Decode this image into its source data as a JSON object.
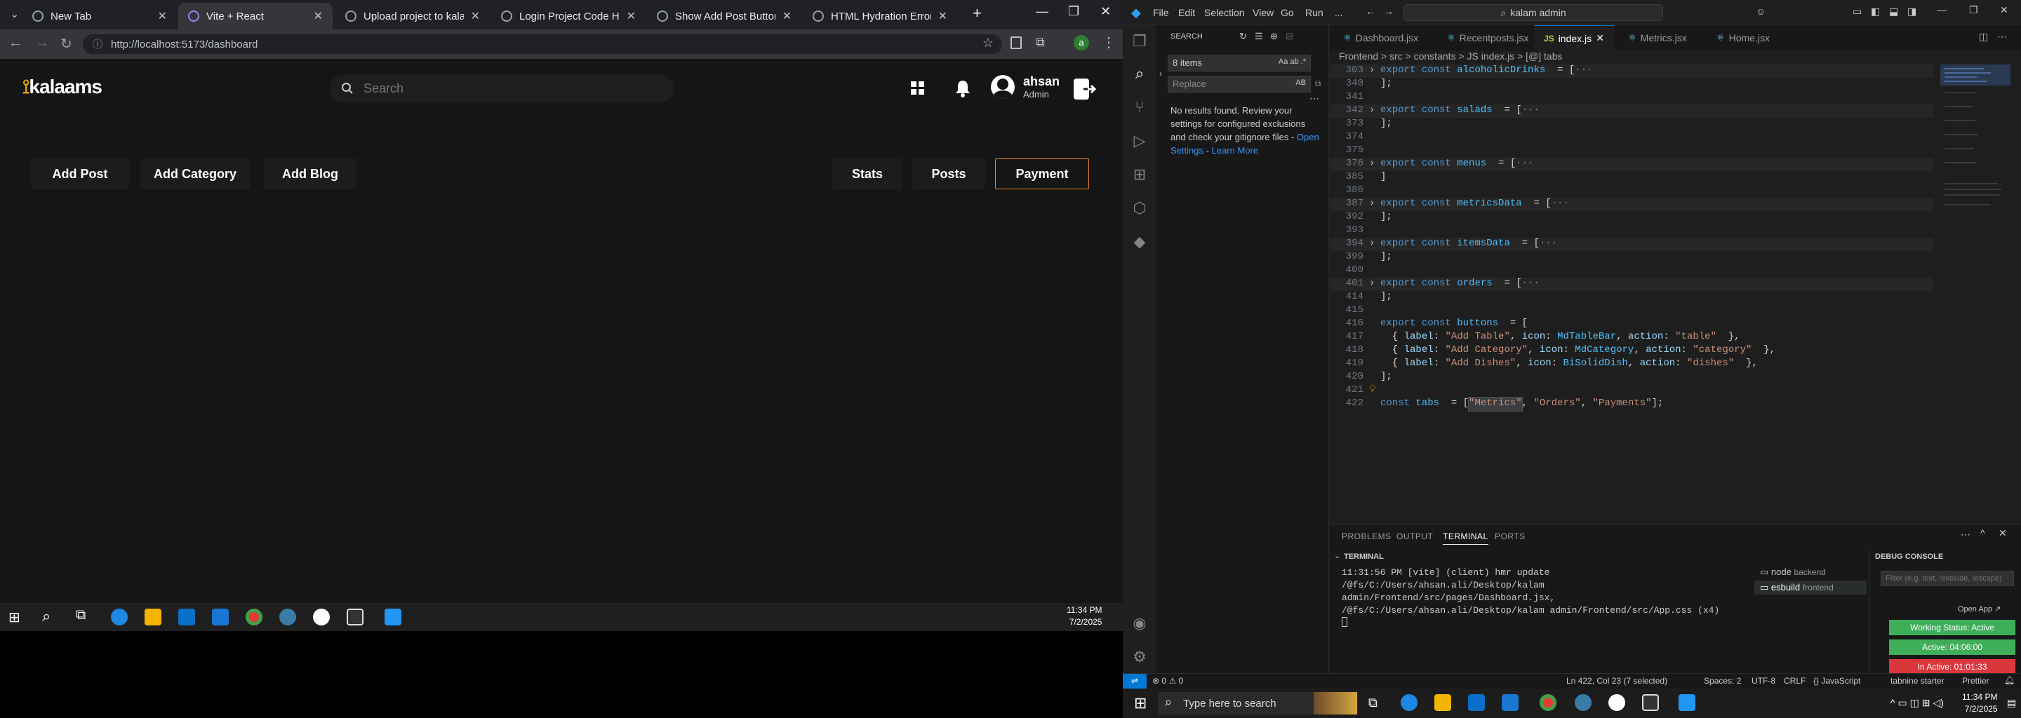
{
  "browser": {
    "tabs": [
      {
        "label": "New Tab"
      },
      {
        "label": "Vite + React"
      },
      {
        "label": "Upload project to kalams.org"
      },
      {
        "label": "Login Project Code Help"
      },
      {
        "label": "Show Add Post Button"
      },
      {
        "label": "HTML Hydration Error Fix"
      }
    ],
    "active_tab_index": 1,
    "url": "http://localhost:5173/dashboard"
  },
  "app": {
    "logo_text": "kalaams",
    "search_placeholder": "Search",
    "user_name": "ahsan",
    "user_role": "Admin",
    "left_actions": [
      "Add Post",
      "Add Category",
      "Add Blog"
    ],
    "right_tabs": [
      "Stats",
      "Posts",
      "Payment"
    ],
    "selected_right_tab": "Payment"
  },
  "taskbar_left": {
    "time": "11:34 PM",
    "date": "7/2/2025"
  },
  "vscode": {
    "menu": [
      "File",
      "Edit",
      "Selection",
      "View",
      "Go",
      "Run",
      "..."
    ],
    "command_center": "kalam admin",
    "search_panel": {
      "title": "SEARCH",
      "query": "8 items",
      "replace_placeholder": "Replace",
      "message": "No results found. Review your settings for configured exclusions and check your gitignore files -",
      "link1": "Open Settings",
      "sep": " - ",
      "link2": "Learn More"
    },
    "editor_tabs": [
      "Dashboard.jsx",
      "Recentposts.jsx",
      "index.js",
      "Metrics.jsx",
      "Home.jsx"
    ],
    "active_editor_tab": "index.js",
    "breadcrumb": "Frontend > src > constants > JS index.js > [@] tabs",
    "code_lines": [
      {
        "n": "303",
        "fold": true,
        "band": true,
        "code": [
          [
            "kw",
            "export "
          ],
          [
            "kw",
            "const "
          ],
          [
            "id",
            "alcoholicDrinks"
          ],
          [
            "",
            "  = ["
          ],
          [
            "dot",
            "···"
          ]
        ]
      },
      {
        "n": "340",
        "code": [
          [
            "",
            "];"
          ]
        ]
      },
      {
        "n": "341",
        "code": []
      },
      {
        "n": "342",
        "fold": true,
        "band": true,
        "code": [
          [
            "kw",
            "export "
          ],
          [
            "kw",
            "const "
          ],
          [
            "id",
            "salads"
          ],
          [
            "",
            "  = ["
          ],
          [
            "dot",
            "···"
          ]
        ]
      },
      {
        "n": "373",
        "code": [
          [
            "",
            "];"
          ]
        ]
      },
      {
        "n": "374",
        "code": []
      },
      {
        "n": "375",
        "code": []
      },
      {
        "n": "376",
        "fold": true,
        "band": true,
        "code": [
          [
            "kw",
            "export "
          ],
          [
            "kw",
            "const "
          ],
          [
            "id",
            "menus"
          ],
          [
            "",
            "  = ["
          ],
          [
            "dot",
            "···"
          ]
        ]
      },
      {
        "n": "385",
        "code": [
          [
            "",
            "]"
          ]
        ]
      },
      {
        "n": "386",
        "code": []
      },
      {
        "n": "387",
        "fold": true,
        "band": true,
        "code": [
          [
            "kw",
            "export "
          ],
          [
            "kw",
            "const "
          ],
          [
            "id",
            "metricsData"
          ],
          [
            "",
            "  = ["
          ],
          [
            "dot",
            "···"
          ]
        ]
      },
      {
        "n": "392",
        "code": [
          [
            "",
            "];"
          ]
        ]
      },
      {
        "n": "393",
        "code": []
      },
      {
        "n": "394",
        "fold": true,
        "band": true,
        "code": [
          [
            "kw",
            "export "
          ],
          [
            "kw",
            "const "
          ],
          [
            "id",
            "itemsData"
          ],
          [
            "",
            "  = ["
          ],
          [
            "dot",
            "···"
          ]
        ]
      },
      {
        "n": "399",
        "code": [
          [
            "",
            "];"
          ]
        ]
      },
      {
        "n": "400",
        "code": []
      },
      {
        "n": "401",
        "fold": true,
        "band": true,
        "code": [
          [
            "kw",
            "export "
          ],
          [
            "kw",
            "const "
          ],
          [
            "id",
            "orders"
          ],
          [
            "",
            "  = ["
          ],
          [
            "dot",
            "···"
          ]
        ]
      },
      {
        "n": "414",
        "code": [
          [
            "",
            "];"
          ]
        ]
      },
      {
        "n": "415",
        "code": []
      },
      {
        "n": "416",
        "code": [
          [
            "kw",
            "export "
          ],
          [
            "kw",
            "const "
          ],
          [
            "id",
            "buttons"
          ],
          [
            "",
            ""
          ],
          [
            "",
            "  = ["
          ]
        ]
      },
      {
        "n": "417",
        "code": [
          [
            "",
            "  { "
          ],
          [
            "pr",
            "label"
          ],
          [
            "",
            ": "
          ],
          [
            "st",
            "\"Add Table\""
          ],
          [
            "",
            ", "
          ],
          [
            "pr",
            "icon"
          ],
          [
            "",
            ": "
          ],
          [
            "id",
            "MdTableBar"
          ],
          [
            "",
            ", "
          ],
          [
            "pr",
            "action"
          ],
          [
            "",
            ": "
          ],
          [
            "st",
            "\"table\""
          ],
          [
            "",
            "  },"
          ]
        ]
      },
      {
        "n": "418",
        "code": [
          [
            "",
            "  { "
          ],
          [
            "pr",
            "label"
          ],
          [
            "",
            ": "
          ],
          [
            "st",
            "\"Add Category\""
          ],
          [
            "",
            ", "
          ],
          [
            "pr",
            "icon"
          ],
          [
            "",
            ": "
          ],
          [
            "id",
            "MdCategory"
          ],
          [
            "",
            ", "
          ],
          [
            "pr",
            "action"
          ],
          [
            "",
            ": "
          ],
          [
            "st",
            "\"category\""
          ],
          [
            "",
            "  },"
          ]
        ]
      },
      {
        "n": "419",
        "code": [
          [
            "",
            "  { "
          ],
          [
            "pr",
            "label"
          ],
          [
            "",
            ": "
          ],
          [
            "st",
            "\"Add Dishes\""
          ],
          [
            "",
            ", "
          ],
          [
            "pr",
            "icon"
          ],
          [
            "",
            ": "
          ],
          [
            "id",
            "BiSolidDish"
          ],
          [
            "",
            ", "
          ],
          [
            "pr",
            "action"
          ],
          [
            "",
            ": "
          ],
          [
            "st",
            "\"dishes\""
          ],
          [
            "",
            "  },"
          ]
        ]
      },
      {
        "n": "420",
        "code": [
          [
            "",
            "];"
          ]
        ]
      },
      {
        "n": "421",
        "code": []
      },
      {
        "n": "422",
        "code": [
          [
            "kw",
            "const "
          ],
          [
            "id",
            "tabs"
          ],
          [
            "",
            "  = ["
          ],
          [
            "st",
            "\"Metrics\""
          ],
          [
            "",
            ", "
          ],
          [
            "st",
            "\"Orders\""
          ],
          [
            "",
            ", "
          ],
          [
            "st",
            "\"Payments\""
          ],
          [
            "",
            "];"
          ]
        ]
      }
    ],
    "panel_tabs": [
      "PROBLEMS",
      "OUTPUT",
      "TERMINAL",
      "PORTS"
    ],
    "active_panel_tab": "TERMINAL",
    "terminal_title": "TERMINAL",
    "terminal_text": "11:31:56 PM [vite] (client) hmr update /@fs/C:/Users/ahsan.ali/Desktop/kalam admin/Frontend/src/pages/Dashboard.jsx, /@fs/C:/Users/ahsan.ali/Desktop/kalam admin/Frontend/src/App.css (x4)",
    "terminal_list": [
      {
        "name": "node",
        "detail": "backend"
      },
      {
        "name": "esbuild",
        "detail": "frontend"
      }
    ],
    "debug_title": "DEBUG CONSOLE",
    "debug_filter_placeholder": "Filter (e.g. text, !exclude, \\escape)",
    "open_app": "Open App ↗",
    "badges": [
      {
        "label": "Working Status: Active",
        "color": "#3fae5a"
      },
      {
        "label": "Active: 04:06:00",
        "color": "#3fae5a"
      },
      {
        "label": "In Active: 01:01:33",
        "color": "#d9363e"
      }
    ],
    "status_left": "⊗ 0 ⚠ 0",
    "status_right": [
      "Ln 422, Col 23 (7 selected)",
      "Spaces: 2",
      "UTF-8",
      "CRLF",
      "{} JavaScript",
      "tabnine starter",
      "Prettier"
    ]
  },
  "taskbar_right": {
    "search_placeholder": "Type here to search",
    "time": "11:34 PM",
    "date": "7/2/2025"
  }
}
